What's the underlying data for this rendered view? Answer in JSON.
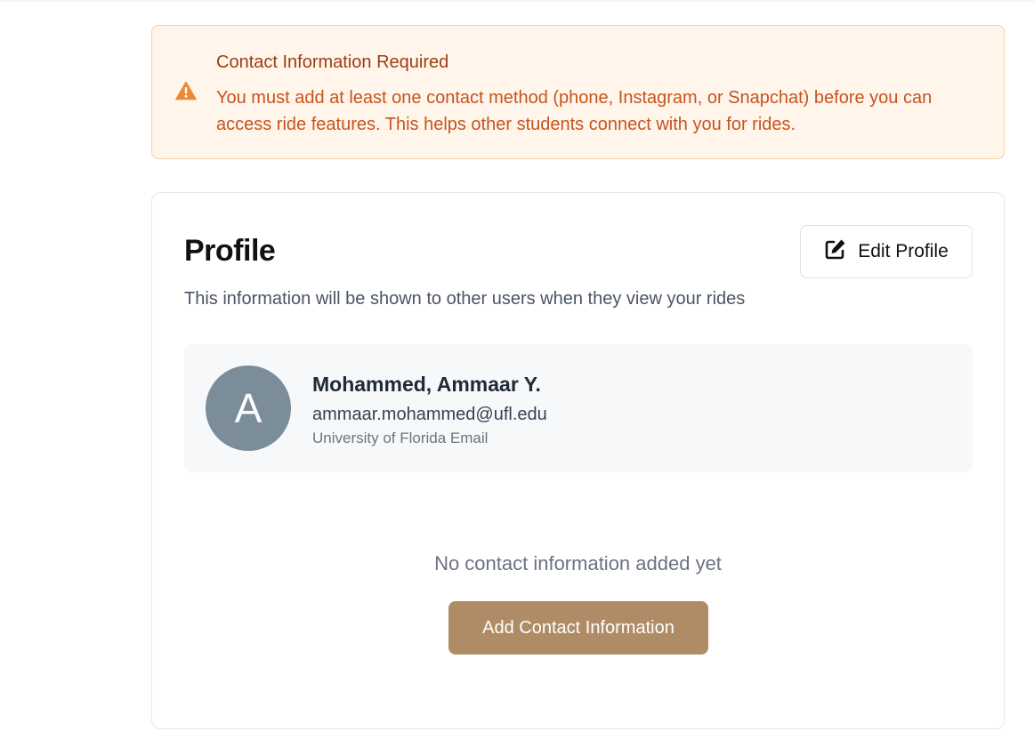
{
  "alert": {
    "icon": "warning-triangle-icon",
    "title": "Contact Information Required",
    "message": "You must add at least one contact method (phone, Instagram, or Snapchat) before you can access ride features. This helps other students connect with you for rides.",
    "accent_color": "#ed8936"
  },
  "profile": {
    "title": "Profile",
    "edit_button": {
      "icon": "edit-icon",
      "label": "Edit Profile"
    },
    "subtitle": "This information will be shown to other users when they view your rides",
    "user": {
      "avatar_initial": "A",
      "name": "Mohammed, Ammaar Y.",
      "email": "ammaar.mohammed@ufl.edu",
      "email_label": "University of Florida Email"
    },
    "empty_state": "No contact information added yet",
    "add_contact_button": "Add Contact Information",
    "brand_color": "#b08c66"
  }
}
